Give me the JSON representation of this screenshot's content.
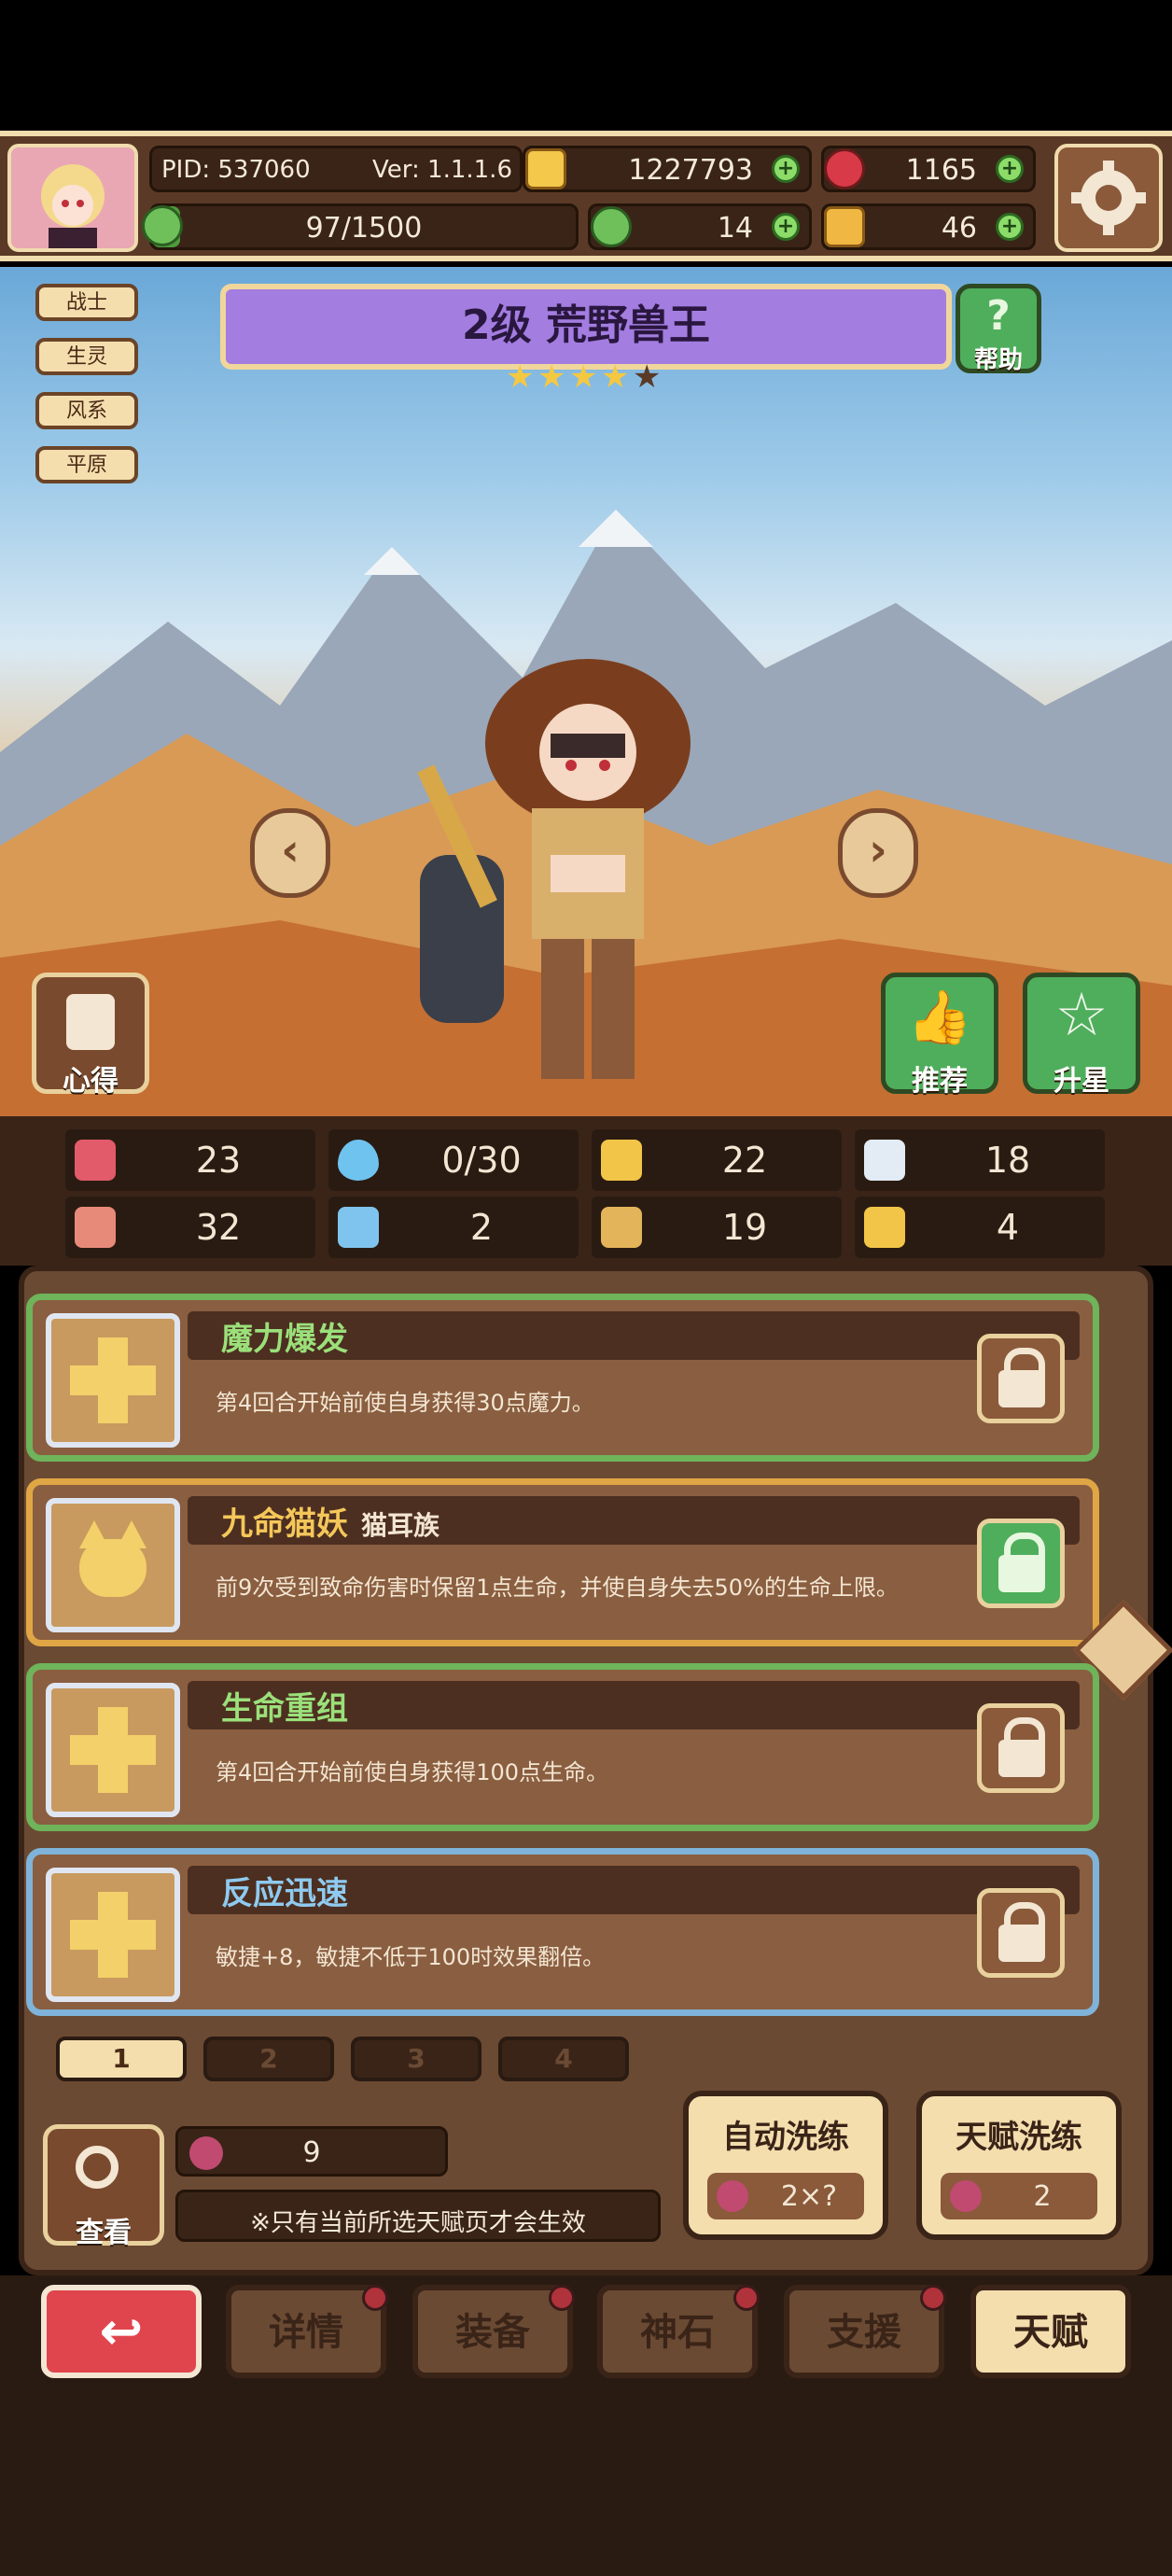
{
  "header": {
    "pid": "PID: 537060",
    "version": "Ver: 1.1.1.6",
    "gold": "1227793",
    "gems": "1165",
    "energy": "97/1500",
    "clover": "14",
    "keys": "46",
    "energy_progress": 0.065
  },
  "tags": [
    "战士",
    "生灵",
    "风系",
    "平原"
  ],
  "hero": {
    "level_name": "2级  荒野兽王",
    "stars_filled": 4,
    "stars_total": 5,
    "help_label": "帮助",
    "notes_label": "心得",
    "recommend_label": "推荐",
    "star_up_label": "升星"
  },
  "stats": [
    {
      "icon": "heart-icon",
      "value": "23"
    },
    {
      "icon": "mana-drop-icon",
      "value": "0/30"
    },
    {
      "icon": "shield-icon",
      "value": "22"
    },
    {
      "icon": "wing-icon",
      "value": "18"
    },
    {
      "icon": "fist-icon",
      "value": "32"
    },
    {
      "icon": "book-icon",
      "value": "2"
    },
    {
      "icon": "boot-icon",
      "value": "19"
    },
    {
      "icon": "horseshoe-icon",
      "value": "4"
    }
  ],
  "talents": [
    {
      "title": "魔力爆发",
      "subtitle": "",
      "desc": "第4回合开始前使自身获得30点魔力。",
      "color": "#9be07a",
      "frame": "#6fb35a",
      "lock": "unlocked"
    },
    {
      "title": "九命猫妖",
      "subtitle": "猫耳族",
      "desc": "前9次受到致命伤害时保留1点生命，并使自身失去50%的生命上限。",
      "color": "#f5c75a",
      "frame": "#e0a645",
      "lock": "locked"
    },
    {
      "title": "生命重组",
      "subtitle": "",
      "desc": "第4回合开始前使自身获得100点生命。",
      "color": "#9be07a",
      "frame": "#6fb35a",
      "lock": "unlocked"
    },
    {
      "title": "反应迅速",
      "subtitle": "",
      "desc": "敏捷+8，敏捷不低于100时效果翻倍。",
      "color": "#8fcaf0",
      "frame": "#7fb3d9",
      "lock": "unlocked"
    }
  ],
  "pages": [
    "1",
    "2",
    "3",
    "4"
  ],
  "bottom": {
    "fruit_count": "9",
    "view_label": "查看",
    "notice": "※只有当前所选天赋页才会生效",
    "auto_reroll_label": "自动洗练",
    "auto_reroll_cost": "2×?",
    "reroll_label": "天赋洗练",
    "reroll_cost": "2"
  },
  "nav": [
    "详情",
    "装备",
    "神石",
    "支援",
    "天赋"
  ]
}
